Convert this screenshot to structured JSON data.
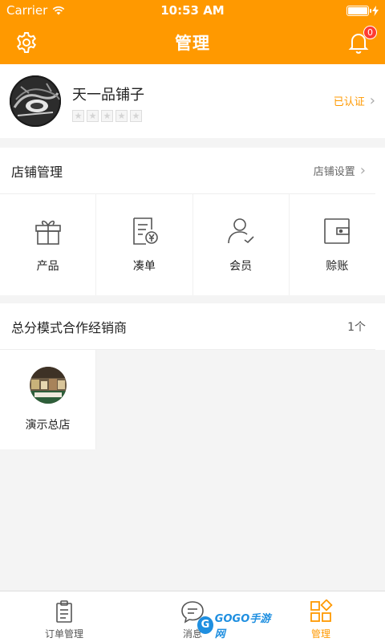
{
  "status_bar": {
    "carrier": "Carrier",
    "time": "10:53 AM",
    "battery_level": 1.0
  },
  "nav": {
    "title": "管理",
    "notification_count": "0",
    "left_icon": "gear-icon",
    "right_icon": "bell-icon"
  },
  "profile": {
    "shop_name": "天一品铺子",
    "verified_label": "已认证",
    "rating_stars": 5,
    "rating_value": 0
  },
  "store_management": {
    "title": "店铺管理",
    "settings_label": "店铺设置",
    "items": [
      {
        "label": "产品",
        "icon": "gift-icon"
      },
      {
        "label": "凑单",
        "icon": "invoice-yen-icon"
      },
      {
        "label": "会员",
        "icon": "member-icon"
      },
      {
        "label": "赊账",
        "icon": "wallet-icon"
      }
    ]
  },
  "distributors": {
    "title": "总分模式合作经销商",
    "count_label": "1个",
    "items": [
      {
        "name": "演示总店"
      }
    ]
  },
  "tabbar": {
    "items": [
      {
        "label": "订单管理",
        "icon": "clipboard-icon",
        "active": false
      },
      {
        "label": "消息",
        "icon": "chat-icon",
        "active": false
      },
      {
        "label": "管理",
        "icon": "grid-icon",
        "active": true
      }
    ]
  },
  "watermark": {
    "text": "GOGO手游网",
    "colors": {
      "blue": "#1f8fe0",
      "red": "#e8402a"
    }
  },
  "colors": {
    "accent": "#ff9900",
    "badge": "#ff3b30",
    "background": "#f4f4f4"
  }
}
